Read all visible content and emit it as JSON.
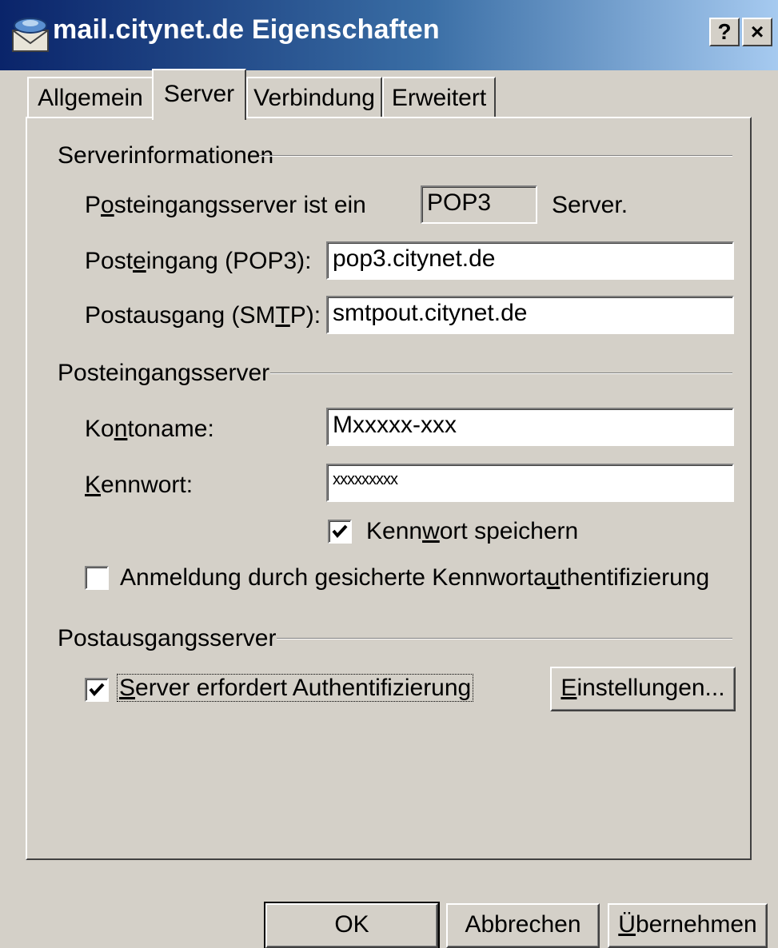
{
  "window": {
    "title": "mail.citynet.de Eigenschaften",
    "help_label": "?",
    "close_label": "×"
  },
  "tabs": [
    {
      "label": "Allgemein",
      "active": false
    },
    {
      "label": "Server",
      "active": true
    },
    {
      "label": "Verbindung",
      "active": false
    },
    {
      "label": "Erweitert",
      "active": false
    }
  ],
  "server_info": {
    "group_label": "Serverinformationen",
    "incoming_type_label": "Posteingangsserver ist ein",
    "incoming_type_value": "POP3",
    "incoming_type_suffix": "Server.",
    "incoming_label": "Posteingang (POP3):",
    "incoming_value": "pop3.citynet.de",
    "outgoing_label": "Postausgang (SMTP):",
    "outgoing_value": "smtpout.citynet.de"
  },
  "incoming_server": {
    "group_label": "Posteingangsserver",
    "account_label": "Kontoname:",
    "account_value": "Mxxxxx-xxx",
    "password_label": "Kennwort:",
    "password_value": "xxxxxxxxx",
    "remember_password_label": "Kennwort speichern",
    "remember_password_checked": true,
    "spa_label": "Anmeldung durch gesicherte Kennwortauthentifizierung",
    "spa_checked": false
  },
  "outgoing_server": {
    "group_label": "Postausgangsserver",
    "auth_required_label": "Server erfordert Authentifizierung",
    "auth_required_checked": true,
    "settings_button": "Einstellungen..."
  },
  "footer": {
    "ok": "OK",
    "cancel": "Abbrechen",
    "apply": "Übernehmen"
  }
}
